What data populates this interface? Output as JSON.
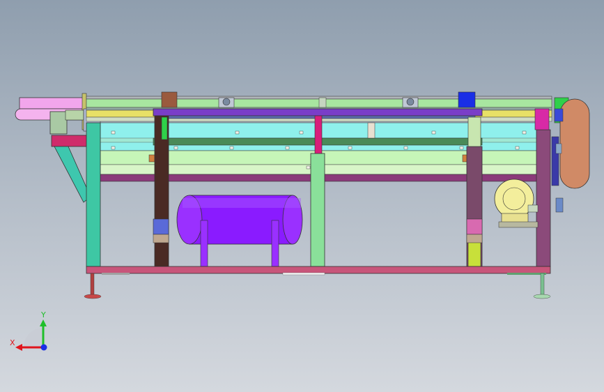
{
  "viewport": {
    "background_top": "#8f9eae",
    "background_bottom": "#d4d8de"
  },
  "triad": {
    "x_label": "X",
    "y_label": "Y",
    "x_color": "#e0141c",
    "y_color": "#1fbf2a",
    "z_color": "#1a2ee6"
  },
  "model": {
    "tank_color": "#8a1bff",
    "roller_color": "#d08a66",
    "motor_color": "#f3ee9c",
    "frame_pink": "#c8557a",
    "frame_purple": "#8b3a7a",
    "belt_cyan": "#8ff0ec",
    "belt_green": "#c6f5b8"
  }
}
